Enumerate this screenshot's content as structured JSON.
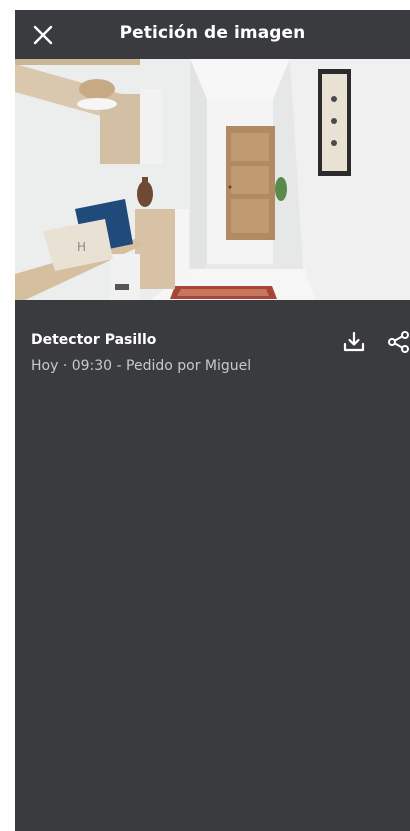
{
  "header": {
    "title": "Petición de imagen",
    "close_icon": "close-icon"
  },
  "image": {
    "description_icon": "hallway-camera-snapshot"
  },
  "details": {
    "device_name": "Detector Pasillo",
    "meta": "Hoy · 09:30 - Pedido por Miguel"
  },
  "actions": {
    "download_icon": "download-icon",
    "share_icon": "share-icon"
  },
  "colors": {
    "background": "#3a3b3e",
    "text_primary": "#ffffff",
    "text_secondary": "#c9c9cb"
  }
}
